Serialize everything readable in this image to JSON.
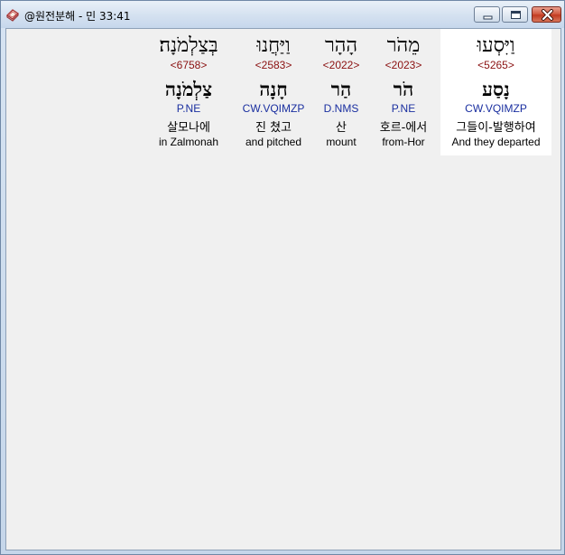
{
  "window": {
    "title": "@원전분해 - 민 33:41",
    "app_icon": "bible-book-icon",
    "buttons": {
      "minimize": "minimize-icon",
      "maximize": "maximize-icon",
      "close": "close-icon"
    }
  },
  "words": [
    {
      "hebrew": "וַיִּסְעוּ",
      "strong": "<5265>",
      "lemma": "נָסַע",
      "morph": "CW.VQIMZP",
      "korean": "그들이-발행하여",
      "english": "And they departed",
      "selected": true
    },
    {
      "hebrew": "מֵהֹר",
      "strong": "<2023>",
      "lemma": "הֹר",
      "morph": "P.NE",
      "korean": "호르-에서",
      "english": "from-Hor",
      "selected": false
    },
    {
      "hebrew": "הָהָר",
      "strong": "<2022>",
      "lemma": "הַר",
      "morph": "D.NMS",
      "korean": "산",
      "english": "mount",
      "selected": false
    },
    {
      "hebrew": "וַיַּחֲנוּ",
      "strong": "<2583>",
      "lemma": "חָנָה",
      "morph": "CW.VQIMZP",
      "korean": "진 쳤고",
      "english": "and pitched",
      "selected": false
    },
    {
      "hebrew": "בְּצַלְמֹנָה׃",
      "strong": "<6758>",
      "lemma": "צַלְמֹנָה",
      "morph": "P.NE",
      "korean": "살모나에",
      "english": "in Zalmonah",
      "selected": false
    }
  ],
  "colors": {
    "strong": "#8a1010",
    "morph": "#1a2fa0",
    "selection": "#ffffff",
    "background": "#f0f0f0"
  }
}
